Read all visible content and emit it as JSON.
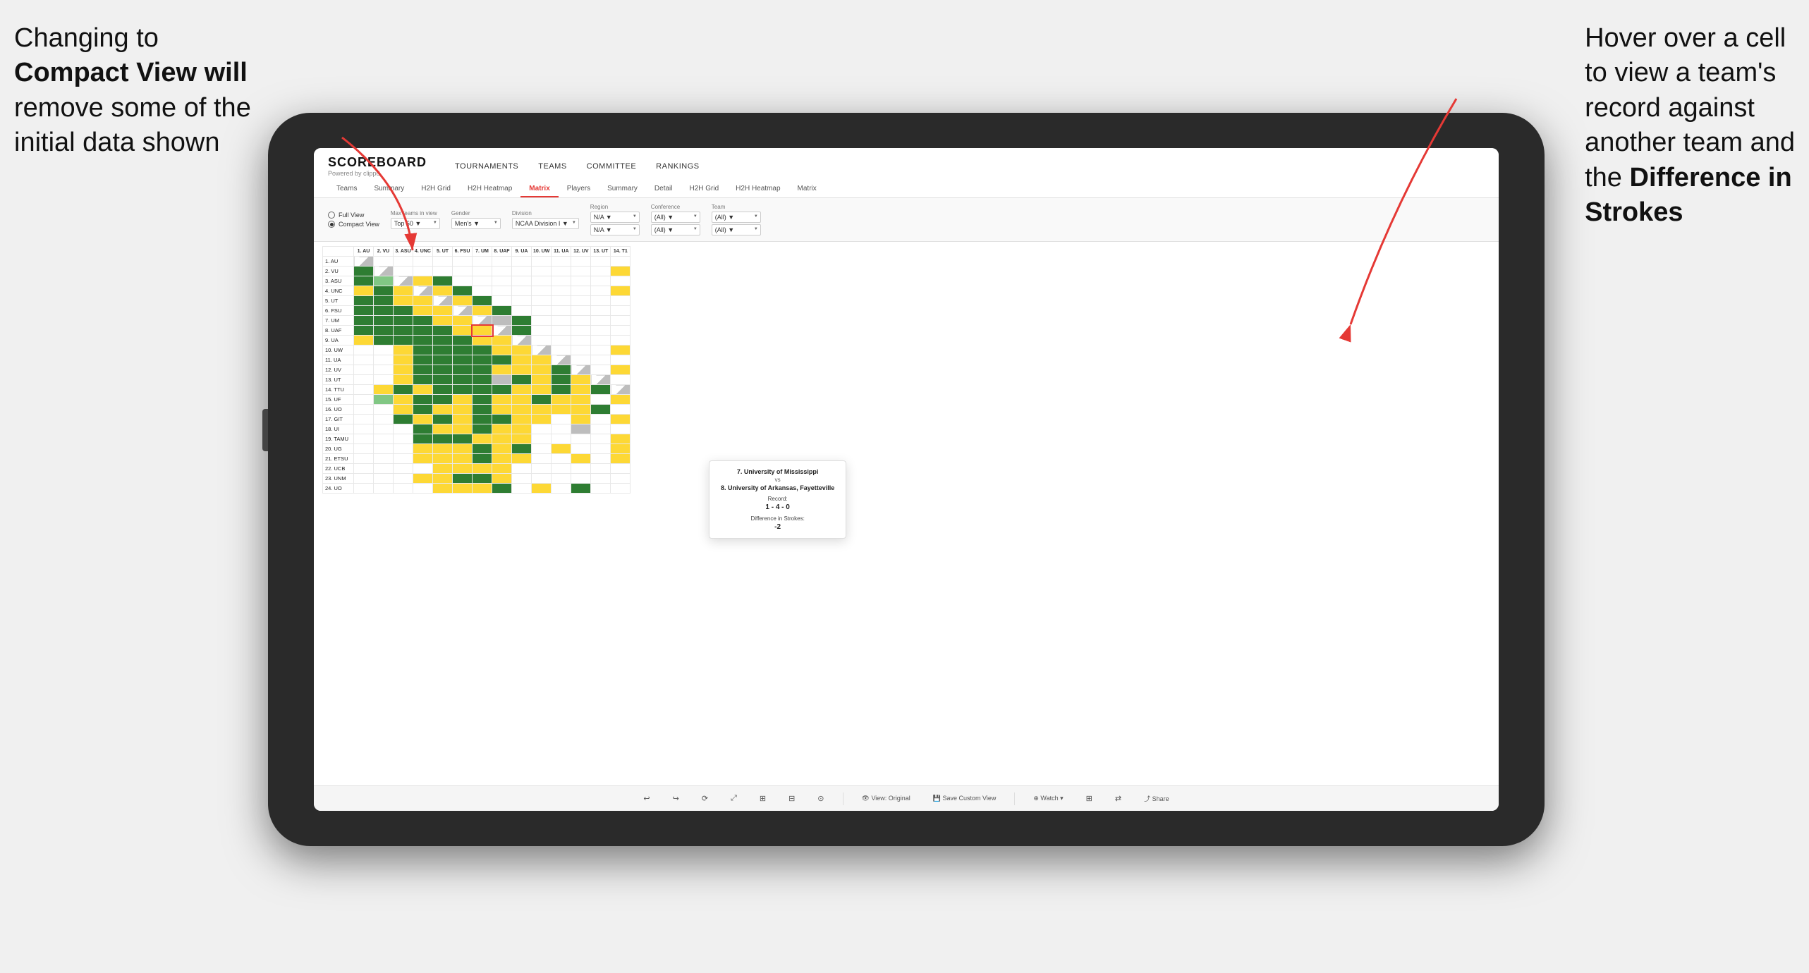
{
  "annotations": {
    "left_line1": "Changing to",
    "left_line2": "Compact View will",
    "left_line3": "remove some of the",
    "left_line4": "initial data shown",
    "right_line1": "Hover over a cell",
    "right_line2": "to view a team's",
    "right_line3": "record against",
    "right_line4": "another team and",
    "right_line5": "the ",
    "right_bold": "Difference in Strokes"
  },
  "header": {
    "logo": "SCOREBOARD",
    "powered_by": "Powered by clippd",
    "nav_items": [
      "TOURNAMENTS",
      "TEAMS",
      "COMMITTEE",
      "RANKINGS"
    ]
  },
  "sub_tabs": {
    "group1": [
      "Teams",
      "Summary",
      "H2H Grid",
      "H2H Heatmap",
      "Matrix"
    ],
    "group2": [
      "Players",
      "Summary",
      "Detail",
      "H2H Grid",
      "H2H Heatmap",
      "Matrix"
    ],
    "active": "Matrix"
  },
  "controls": {
    "view_options": [
      "Full View",
      "Compact View"
    ],
    "selected_view": "Compact View",
    "max_teams_label": "Max teams in view",
    "max_teams_value": "Top 50",
    "gender_label": "Gender",
    "gender_value": "Men's",
    "division_label": "Division",
    "division_value": "NCAA Division I",
    "region_label": "Region",
    "region_value": "N/A",
    "conference_label": "Conference",
    "conference_values": [
      "(All)",
      "(All)",
      "(All)"
    ],
    "team_label": "Team",
    "team_value": "(All)"
  },
  "matrix": {
    "col_headers": [
      "1. AU",
      "2. VU",
      "3. ASU",
      "4. UNC",
      "5. UT",
      "6. FSU",
      "7. UM",
      "8. UAF",
      "9. UA",
      "10. UW",
      "11. UA",
      "12. UV",
      "13. UT",
      "14. T1"
    ],
    "rows": [
      {
        "label": "1. AU"
      },
      {
        "label": "2. VU"
      },
      {
        "label": "3. ASU"
      },
      {
        "label": "4. UNC"
      },
      {
        "label": "5. UT"
      },
      {
        "label": "6. FSU"
      },
      {
        "label": "7. UM"
      },
      {
        "label": "8. UAF"
      },
      {
        "label": "9. UA"
      },
      {
        "label": "10. UW"
      },
      {
        "label": "11. UA"
      },
      {
        "label": "12. UV"
      },
      {
        "label": "13. UT"
      },
      {
        "label": "14. TTU"
      },
      {
        "label": "15. UF"
      },
      {
        "label": "16. UO"
      },
      {
        "label": "17. GIT"
      },
      {
        "label": "18. UI"
      },
      {
        "label": "19. TAMU"
      },
      {
        "label": "20. UG"
      },
      {
        "label": "21. ETSU"
      },
      {
        "label": "22. UCB"
      },
      {
        "label": "23. UNM"
      },
      {
        "label": "24. UO"
      }
    ]
  },
  "tooltip": {
    "team1": "7. University of Mississippi",
    "vs": "vs",
    "team2": "8. University of Arkansas, Fayetteville",
    "record_label": "Record:",
    "record_value": "1 - 4 - 0",
    "strokes_label": "Difference in Strokes:",
    "strokes_value": "-2"
  },
  "bottom_toolbar": {
    "buttons": [
      "↩",
      "↪",
      "⟳",
      "⤢",
      "⊞",
      "⊟",
      "⊙",
      "View: Original",
      "Save Custom View",
      "Watch ▾",
      "⊞",
      "⇄",
      "Share"
    ]
  }
}
